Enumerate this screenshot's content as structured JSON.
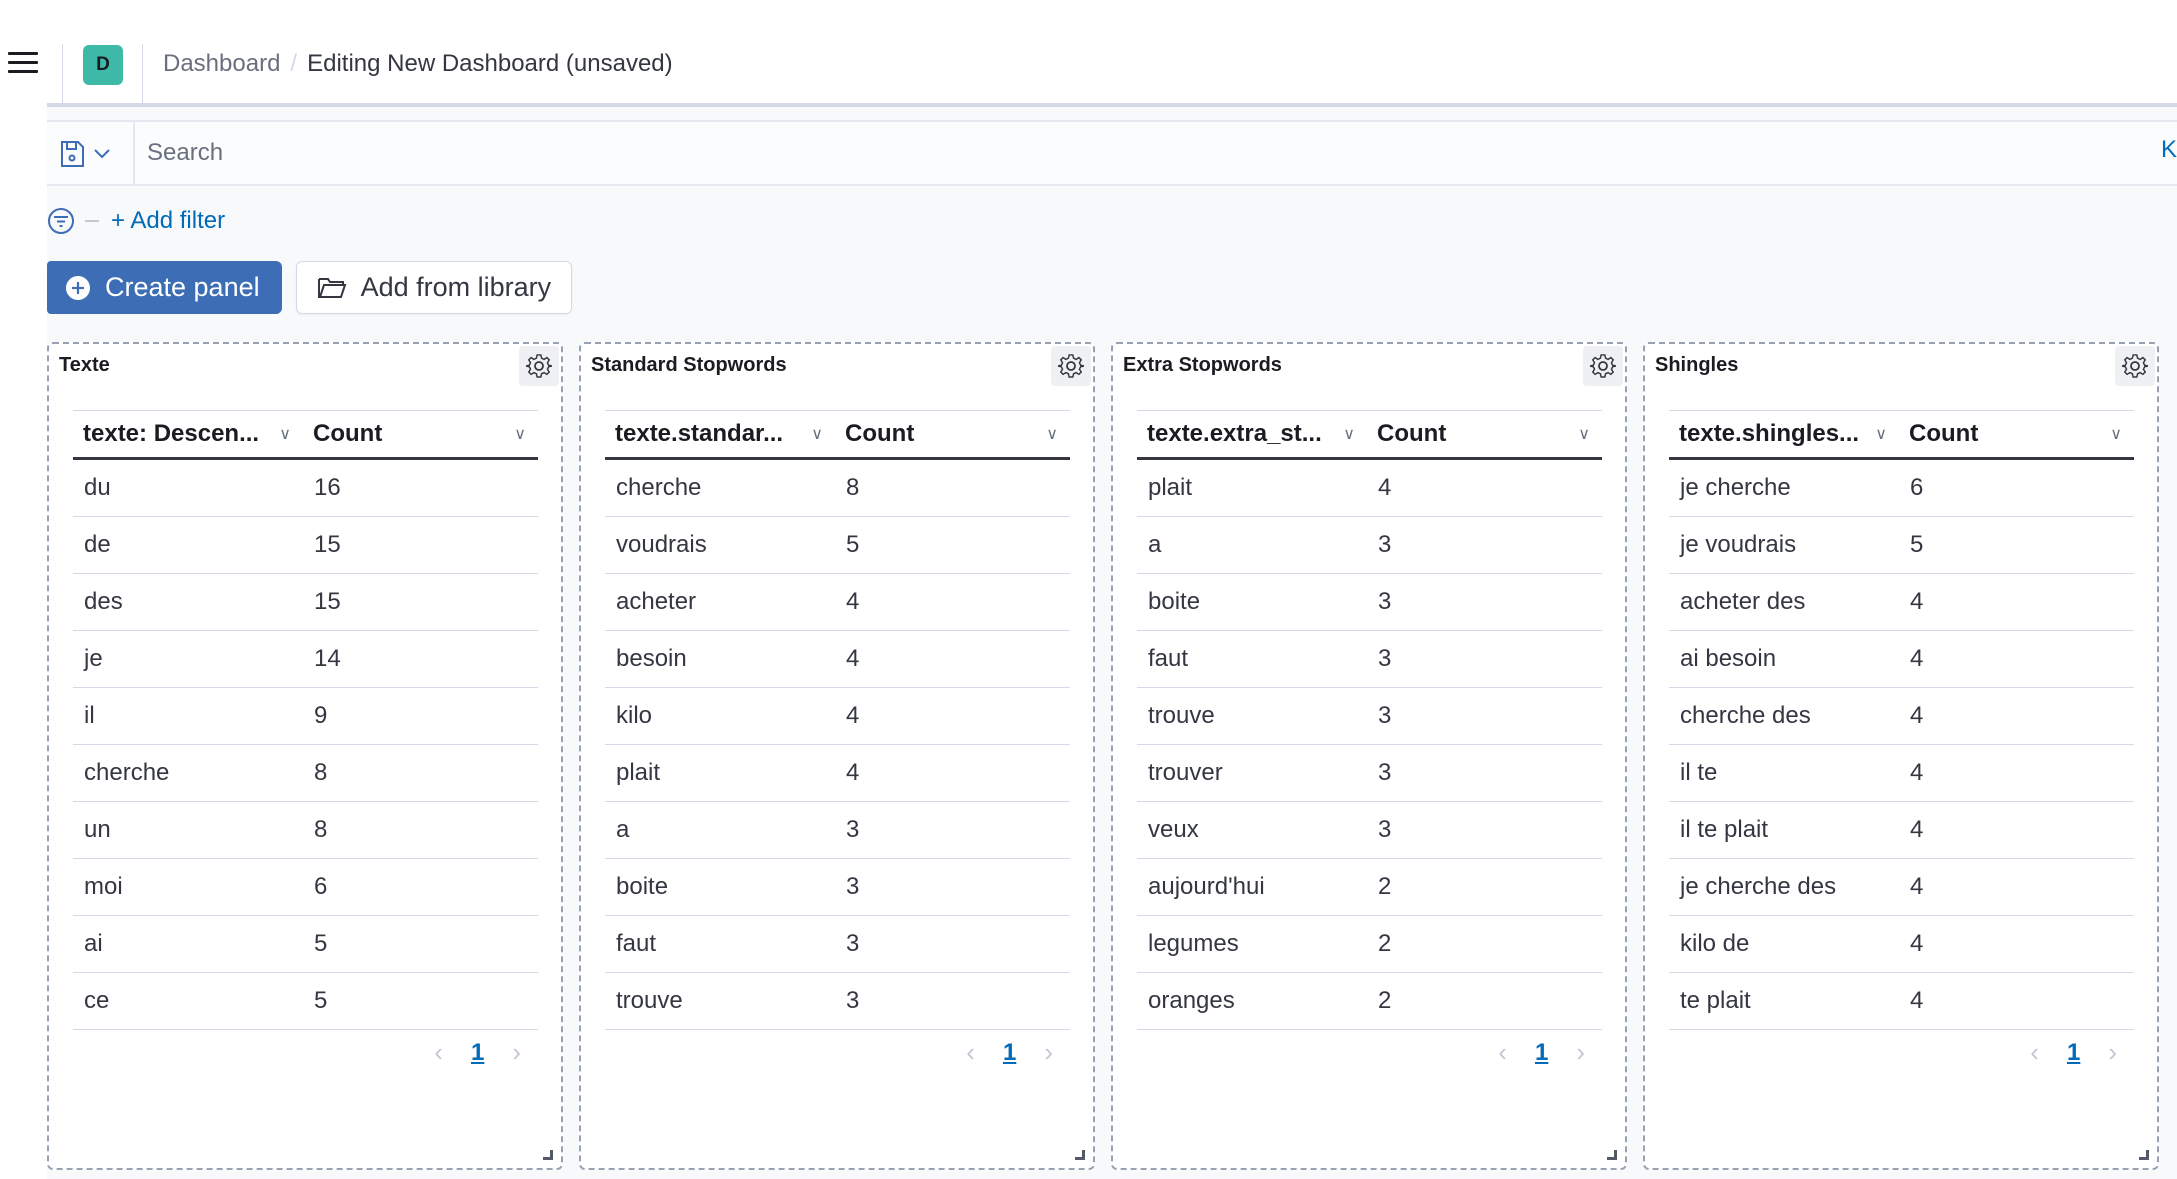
{
  "header": {
    "space_initial": "D",
    "breadcrumbs": [
      "Dashboard",
      "Editing New Dashboard (unsaved)"
    ],
    "separator": "/"
  },
  "query": {
    "search_placeholder": "Search",
    "search_value": "",
    "language_label": "K"
  },
  "filters": {
    "add_filter_label": "+ Add filter"
  },
  "actions": {
    "create_panel_label": "Create panel",
    "add_from_library_label": "Add from library"
  },
  "colors": {
    "primary": "#3d6db5",
    "link": "#006bb8",
    "space_badge": "#3eb9a8"
  },
  "panels": [
    {
      "title": "Texte",
      "columns": [
        "texte: Descen...",
        "Count"
      ],
      "rows": [
        [
          "du",
          "16"
        ],
        [
          "de",
          "15"
        ],
        [
          "des",
          "15"
        ],
        [
          "je",
          "14"
        ],
        [
          "il",
          "9"
        ],
        [
          "cherche",
          "8"
        ],
        [
          "un",
          "8"
        ],
        [
          "moi",
          "6"
        ],
        [
          "ai",
          "5"
        ],
        [
          "ce",
          "5"
        ]
      ],
      "page": "1"
    },
    {
      "title": "Standard Stopwords",
      "columns": [
        "texte.standar...",
        "Count"
      ],
      "rows": [
        [
          "cherche",
          "8"
        ],
        [
          "voudrais",
          "5"
        ],
        [
          "acheter",
          "4"
        ],
        [
          "besoin",
          "4"
        ],
        [
          "kilo",
          "4"
        ],
        [
          "plait",
          "4"
        ],
        [
          "a",
          "3"
        ],
        [
          "boite",
          "3"
        ],
        [
          "faut",
          "3"
        ],
        [
          "trouve",
          "3"
        ]
      ],
      "page": "1"
    },
    {
      "title": "Extra Stopwords",
      "columns": [
        "texte.extra_st...",
        "Count"
      ],
      "rows": [
        [
          "plait",
          "4"
        ],
        [
          "a",
          "3"
        ],
        [
          "boite",
          "3"
        ],
        [
          "faut",
          "3"
        ],
        [
          "trouve",
          "3"
        ],
        [
          "trouver",
          "3"
        ],
        [
          "veux",
          "3"
        ],
        [
          "aujourd'hui",
          "2"
        ],
        [
          "legumes",
          "2"
        ],
        [
          "oranges",
          "2"
        ]
      ],
      "page": "1"
    },
    {
      "title": "Shingles",
      "columns": [
        "texte.shingles...",
        "Count"
      ],
      "rows": [
        [
          "je cherche",
          "6"
        ],
        [
          "je voudrais",
          "5"
        ],
        [
          "acheter des",
          "4"
        ],
        [
          "ai besoin",
          "4"
        ],
        [
          "cherche des",
          "4"
        ],
        [
          "il te",
          "4"
        ],
        [
          "il te plait",
          "4"
        ],
        [
          "je cherche des",
          "4"
        ],
        [
          "kilo de",
          "4"
        ],
        [
          "te plait",
          "4"
        ]
      ],
      "page": "1"
    }
  ]
}
